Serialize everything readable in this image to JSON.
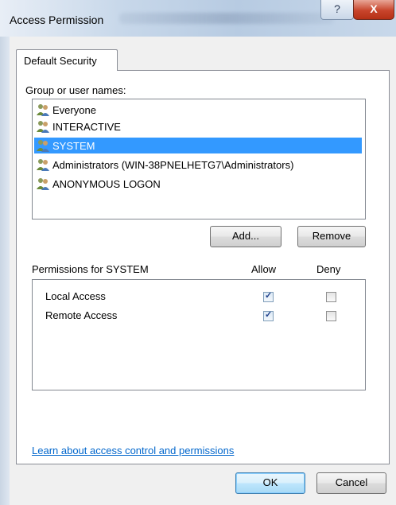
{
  "window": {
    "title": "Access Permission",
    "help_glyph": "?",
    "close_glyph": "X"
  },
  "tab": {
    "label": "Default Security"
  },
  "group_list": {
    "label": "Group or user names:",
    "items": [
      {
        "name": "Everyone",
        "icon": "users-icon",
        "selected": false
      },
      {
        "name": "INTERACTIVE",
        "icon": "users-icon",
        "selected": false
      },
      {
        "name": "SYSTEM",
        "icon": "users-icon",
        "selected": true
      },
      {
        "name": "Administrators (WIN-38PNELHETG7\\Administrators)",
        "icon": "users-icon",
        "selected": false
      },
      {
        "name": "ANONYMOUS LOGON",
        "icon": "users-icon",
        "selected": false
      }
    ]
  },
  "buttons": {
    "add": "Add...",
    "remove": "Remove",
    "ok": "OK",
    "cancel": "Cancel"
  },
  "permissions": {
    "title": "Permissions for SYSTEM",
    "allow_label": "Allow",
    "deny_label": "Deny",
    "rows": [
      {
        "name": "Local Access",
        "allow": true,
        "deny": false
      },
      {
        "name": "Remote Access",
        "allow": true,
        "deny": false
      }
    ]
  },
  "link": {
    "text": "Learn about access control and permissions"
  },
  "colors": {
    "selection": "#3399ff",
    "link": "#0066cc",
    "close_button": "#c8452c"
  }
}
